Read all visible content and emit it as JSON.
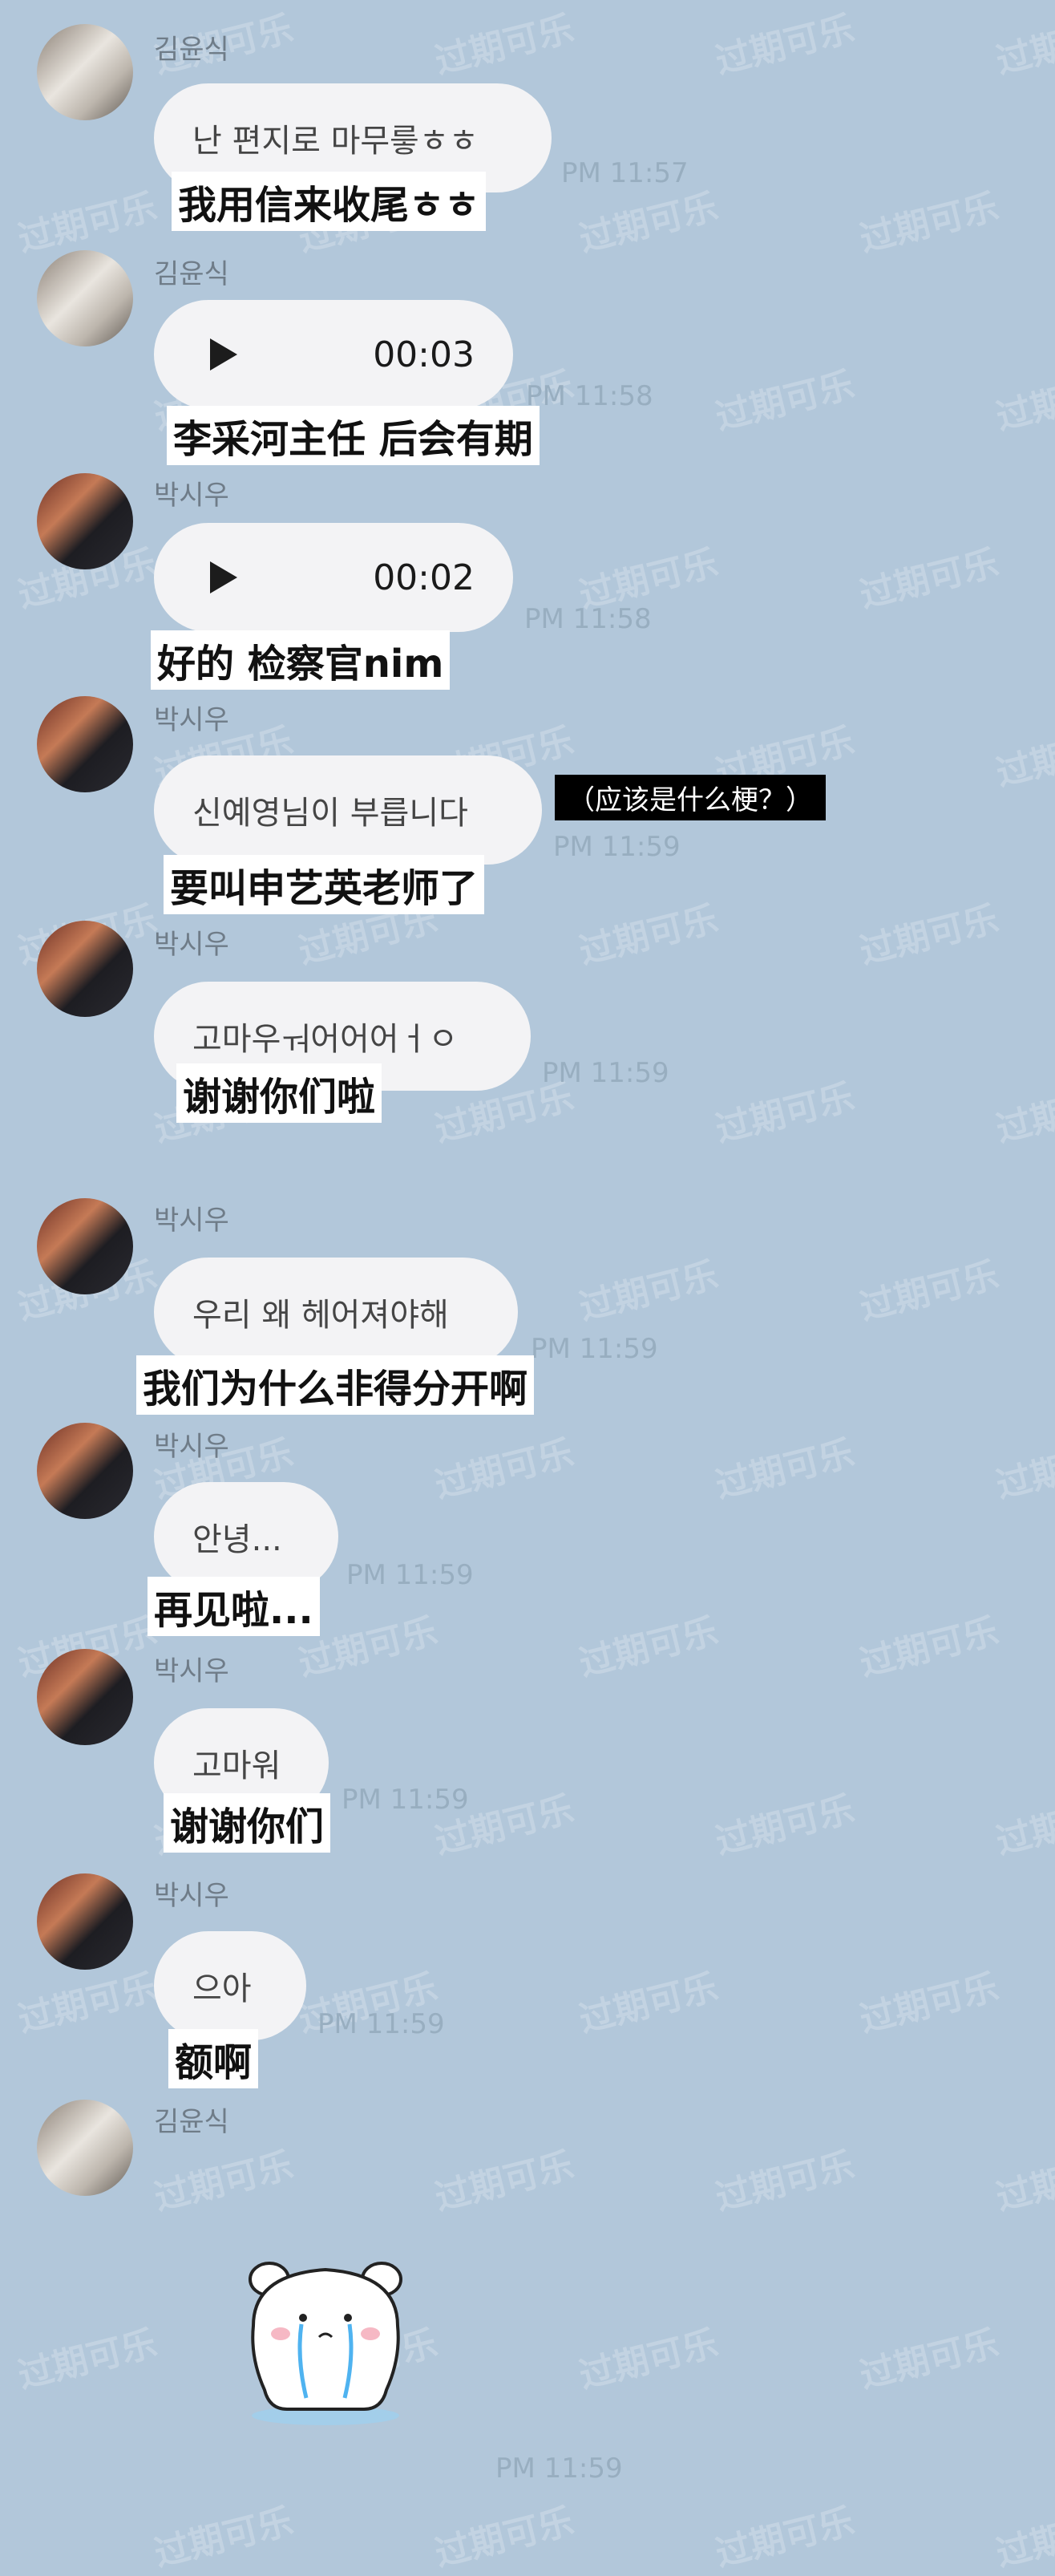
{
  "watermark": "过期可乐",
  "colors": {
    "background": "#b2c7da",
    "bubble": "#f3f3f5",
    "time": "#98aec0"
  },
  "messages": [
    {
      "sender": "김윤식",
      "text": "난 편지로 마무릏ㅎㅎ",
      "time": "PM 11:57",
      "subtitle": "我用信来收尾ㅎㅎ"
    },
    {
      "sender": "김윤식",
      "voice_duration": "00:03",
      "time": "PM 11:58",
      "subtitle": "李采河主任 后会有期"
    },
    {
      "sender": "박시우",
      "voice_duration": "00:02",
      "time": "PM 11:58",
      "subtitle": "好的 检察官nim"
    },
    {
      "sender": "박시우",
      "text": "신예영님이 부릅니다",
      "time": "PM 11:59",
      "subtitle": "要叫申艺英老师了",
      "note": "（应该是什么梗？）"
    },
    {
      "sender": "박시우",
      "text": "고마우ㅝ어어어ㅓㅇ",
      "time": "PM 11:59",
      "subtitle": "谢谢你们啦"
    },
    {
      "sender": "박시우",
      "text": "우리 왜 헤어져야해",
      "time": "PM 11:59",
      "subtitle": "我们为什么非得分开啊"
    },
    {
      "sender": "박시우",
      "text": "안녕...",
      "time": "PM 11:59",
      "subtitle": "再见啦..."
    },
    {
      "sender": "박시우",
      "text": "고마워",
      "time": "PM 11:59",
      "subtitle": "谢谢你们"
    },
    {
      "sender": "박시우",
      "text": "으아",
      "time": "PM 11:59",
      "subtitle": "额啊"
    },
    {
      "sender": "김윤식",
      "sticker": "crying-bear-sticker",
      "time": "PM 11:59"
    }
  ]
}
